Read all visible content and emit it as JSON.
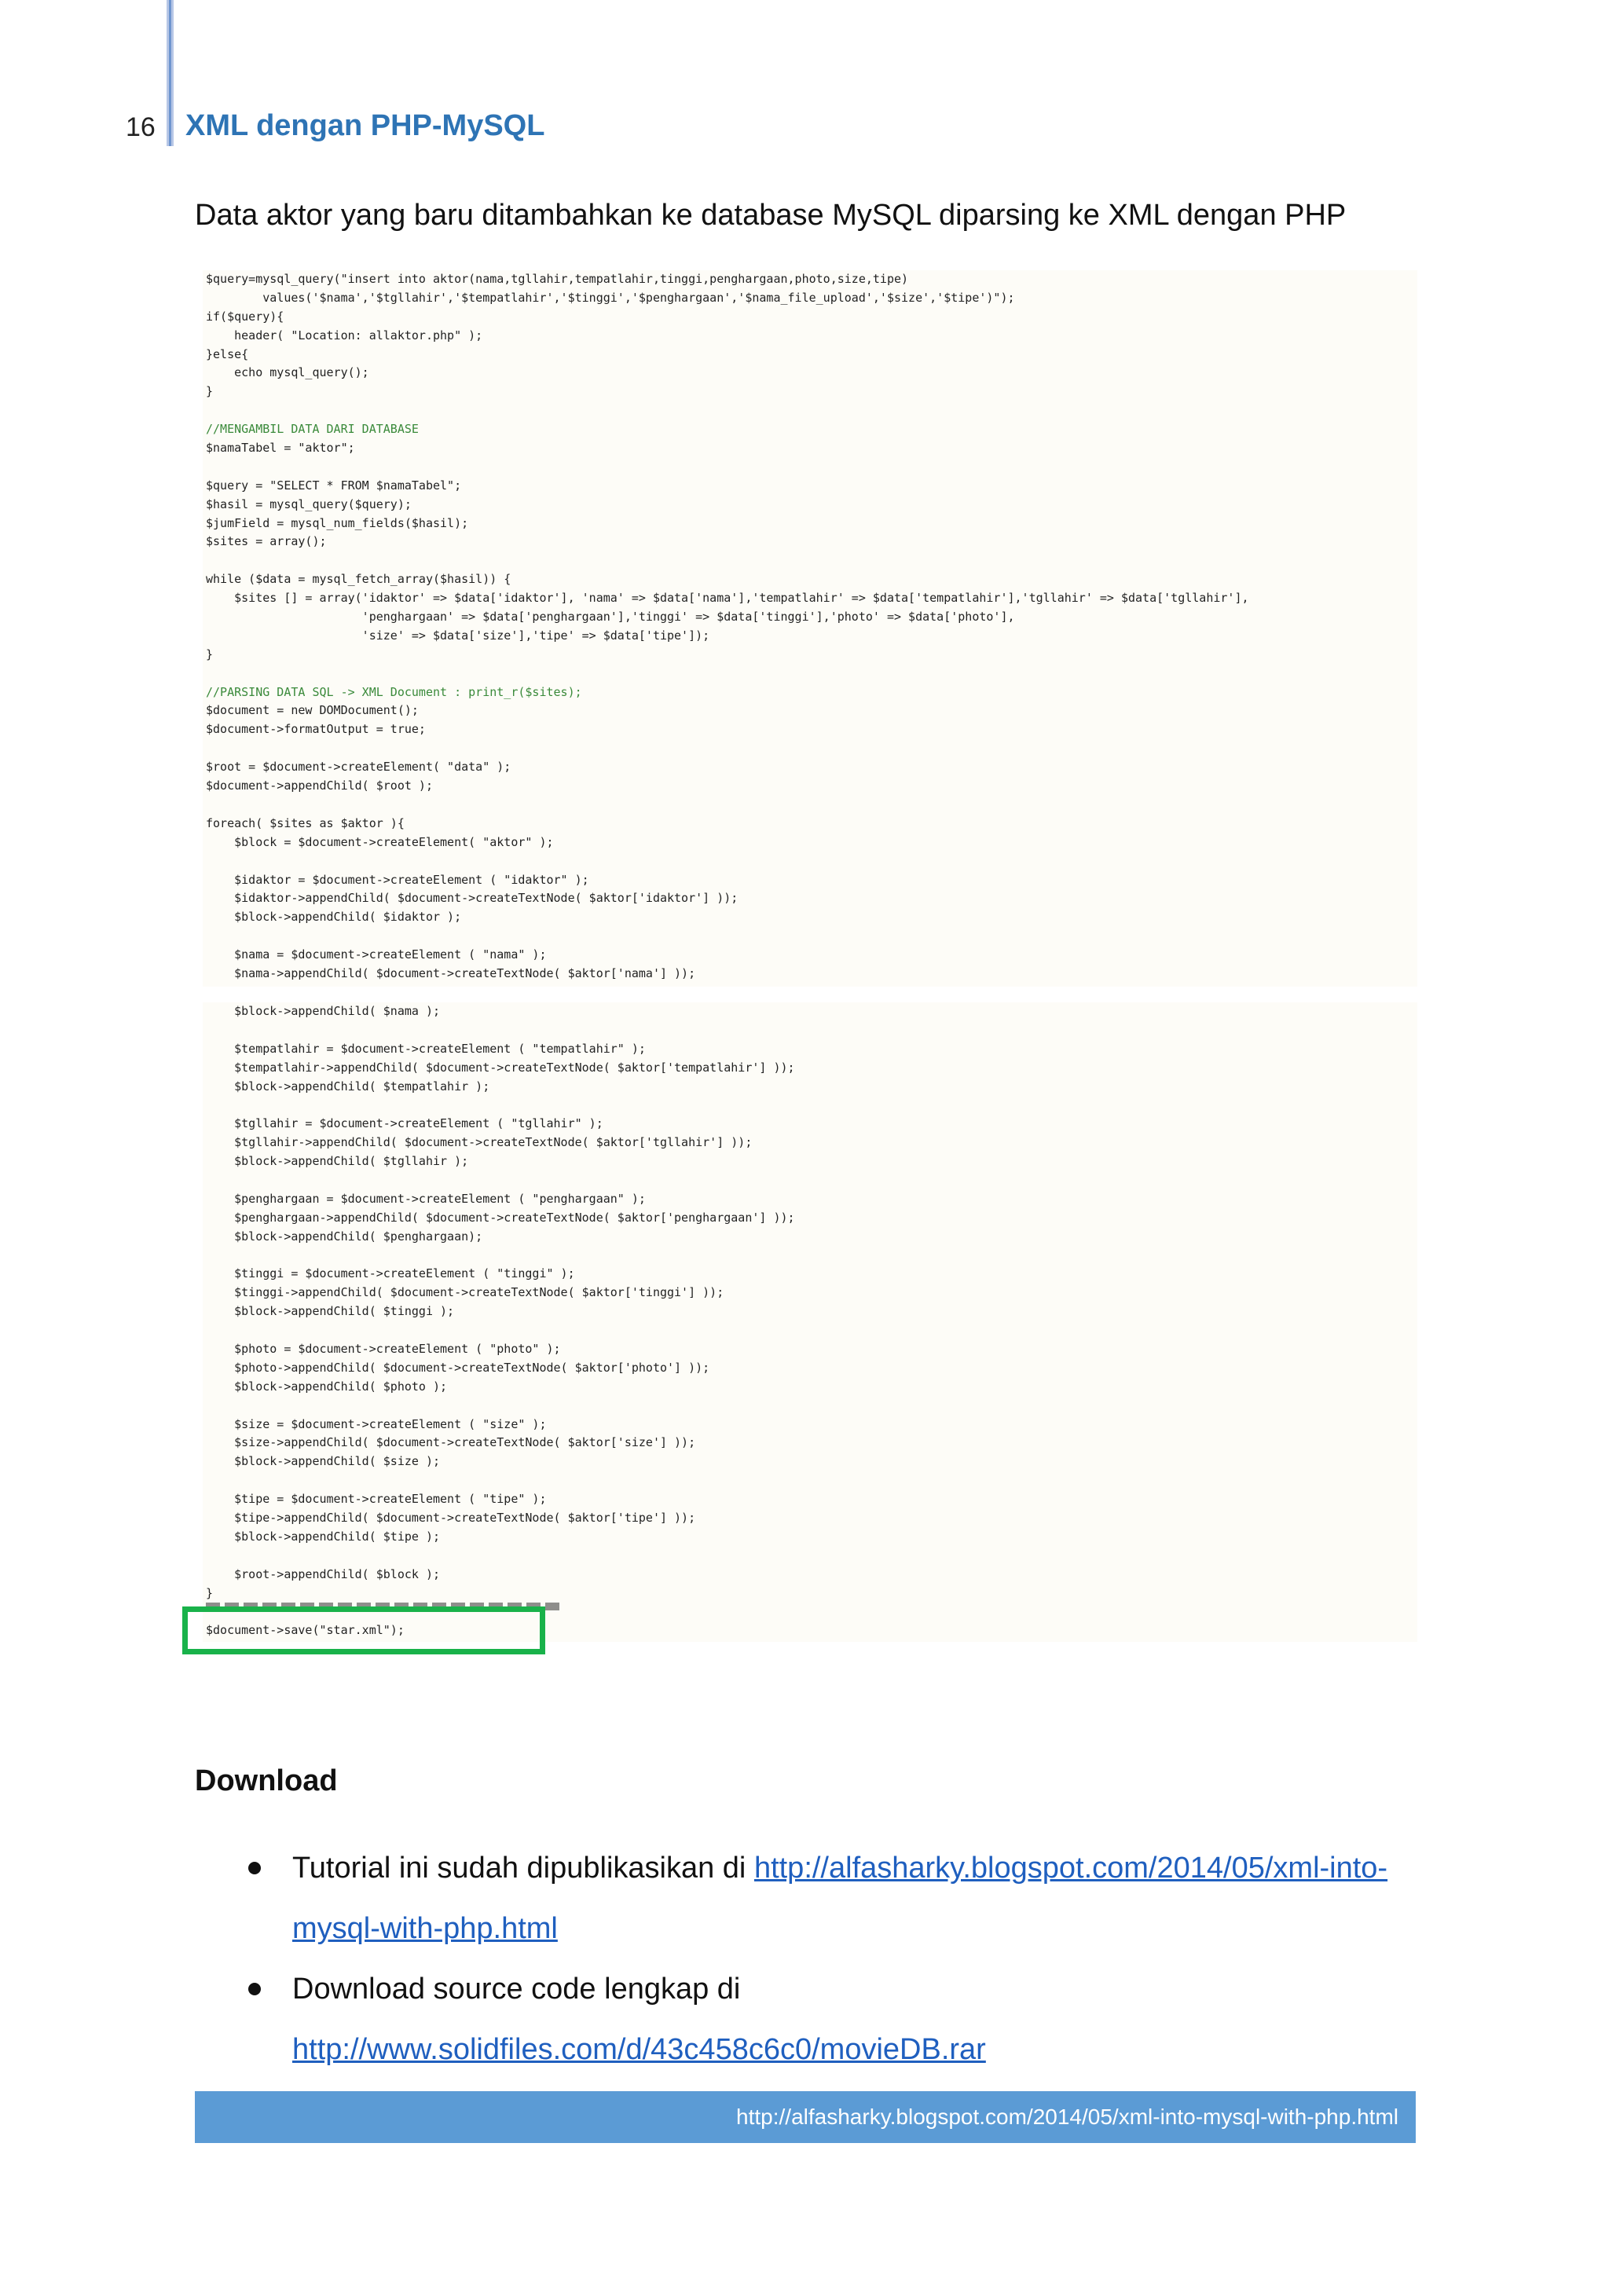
{
  "header": {
    "page_number": "16",
    "title": "XML dengan PHP-MySQL"
  },
  "intro": "Data aktor yang baru ditambahkan ke database MySQL diparsing ke XML dengan PHP",
  "code_part1": [
    "$query=mysql_query(\"insert into aktor(nama,tgllahir,tempatlahir,tinggi,penghargaan,photo,size,tipe)",
    "        values('$nama','$tgllahir','$tempatlahir','$tinggi','$penghargaan','$nama_file_upload','$size','$tipe')\");",
    "if($query){",
    "    header( \"Location: allaktor.php\" );",
    "}else{",
    "    echo mysql_query();",
    "}",
    "",
    "//MENGAMBIL DATA DARI DATABASE",
    "$namaTabel = \"aktor\";",
    "",
    "$query = \"SELECT * FROM $namaTabel\";",
    "$hasil = mysql_query($query);",
    "$jumField = mysql_num_fields($hasil);",
    "$sites = array();",
    "",
    "while ($data = mysql_fetch_array($hasil)) {",
    "    $sites [] = array('idaktor' => $data['idaktor'], 'nama' => $data['nama'],'tempatlahir' => $data['tempatlahir'],'tgllahir' => $data['tgllahir'],",
    "                      'penghargaan' => $data['penghargaan'],'tinggi' => $data['tinggi'],'photo' => $data['photo'],",
    "                      'size' => $data['size'],'tipe' => $data['tipe']);",
    "}",
    "",
    "//PARSING DATA SQL -> XML Document : print_r($sites);",
    "$document = new DOMDocument();",
    "$document->formatOutput = true;",
    "",
    "$root = $document->createElement( \"data\" );",
    "$document->appendChild( $root );",
    "",
    "foreach( $sites as $aktor ){",
    "    $block = $document->createElement( \"aktor\" );",
    "",
    "    $idaktor = $document->createElement ( \"idaktor\" );",
    "    $idaktor->appendChild( $document->createTextNode( $aktor['idaktor'] ));",
    "    $block->appendChild( $idaktor );",
    "",
    "    $nama = $document->createElement ( \"nama\" );",
    "    $nama->appendChild( $document->createTextNode( $aktor['nama'] ));"
  ],
  "code_part2": [
    "    $block->appendChild( $nama );",
    "",
    "    $tempatlahir = $document->createElement ( \"tempatlahir\" );",
    "    $tempatlahir->appendChild( $document->createTextNode( $aktor['tempatlahir'] ));",
    "    $block->appendChild( $tempatlahir );",
    "",
    "    $tgllahir = $document->createElement ( \"tgllahir\" );",
    "    $tgllahir->appendChild( $document->createTextNode( $aktor['tgllahir'] ));",
    "    $block->appendChild( $tgllahir );",
    "",
    "    $penghargaan = $document->createElement ( \"penghargaan\" );",
    "    $penghargaan->appendChild( $document->createTextNode( $aktor['penghargaan'] ));",
    "    $block->appendChild( $penghargaan);",
    "",
    "    $tinggi = $document->createElement ( \"tinggi\" );",
    "    $tinggi->appendChild( $document->createTextNode( $aktor['tinggi'] ));",
    "    $block->appendChild( $tinggi );",
    "",
    "    $photo = $document->createElement ( \"photo\" );",
    "    $photo->appendChild( $document->createTextNode( $aktor['photo'] ));",
    "    $block->appendChild( $photo );",
    "",
    "    $size = $document->createElement ( \"size\" );",
    "    $size->appendChild( $document->createTextNode( $aktor['size'] ));",
    "    $block->appendChild( $size );",
    "",
    "    $tipe = $document->createElement ( \"tipe\" );",
    "    $tipe->appendChild( $document->createTextNode( $aktor['tipe'] ));",
    "    $block->appendChild( $tipe );",
    "",
    "    $root->appendChild( $block );",
    "}",
    "",
    "$document->save(\"star.xml\");"
  ],
  "download": {
    "heading": "Download",
    "items": [
      {
        "text": "Tutorial ini sudah dipublikasikan di ",
        "link": "http://alfasharky.blogspot.com/2014/05/xml-into-mysql-with-php.html"
      },
      {
        "text": "Download source code lengkap di",
        "link": "http://www.solidfiles.com/d/43c458c6c0/movieDB.rar"
      }
    ]
  },
  "footer": {
    "url": "http://alfasharky.blogspot.com/2014/05/xml-into-mysql-with-php.html"
  },
  "colors": {
    "header_title": "#2e74b5",
    "highlight_box": "#19b24a",
    "footer_band": "#5b9bd5",
    "link": "#1f5fbf"
  }
}
